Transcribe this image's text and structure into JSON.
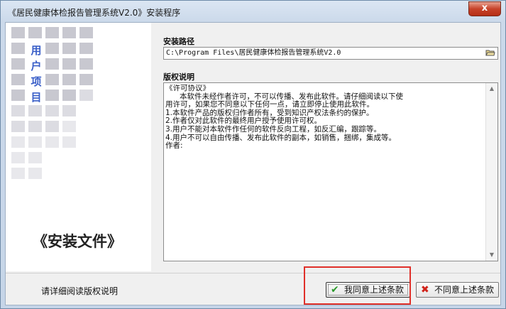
{
  "window": {
    "title": "《居民健康体检报告管理系统V2.0》安装程序",
    "close_label": "x"
  },
  "left_panel": {
    "vertical_chars": [
      "用",
      "户",
      "项",
      "目"
    ],
    "big_title": "《安装文件》"
  },
  "install_path": {
    "label": "安装路径",
    "value": "C:\\Program Files\\居民健康体检报告管理系统V2.0",
    "browse_icon": "folder-open-icon"
  },
  "license": {
    "label": "版权说明",
    "text": "《许可协议》\n      本软件未经作者许可，不可以传播、发布此软件。请仔细阅读以下使\n用许可，如果您不同意以下任何一点，请立即停止使用此软件。\n1.本软件产品的版权归作者所有，受到知识产权法条约的保护。\n2.作者仅对此软件的最终用户授予使用许可权。\n3.用户不能对本软件作任何的软件反向工程，如反汇编，跟踪等。\n4.用户不可以自由传播、发布此软件的副本，如销售，捆绑，集成等。\n作者:"
  },
  "bottom": {
    "hint": "请详细阅读版权说明",
    "agree_label": "我同意上述条款",
    "disagree_label": "不同意上述条款"
  },
  "colors": {
    "accent_text": "#3a5fc8",
    "highlight": "#e0302a",
    "check": "#2b9a2b",
    "cross": "#d0231a"
  }
}
